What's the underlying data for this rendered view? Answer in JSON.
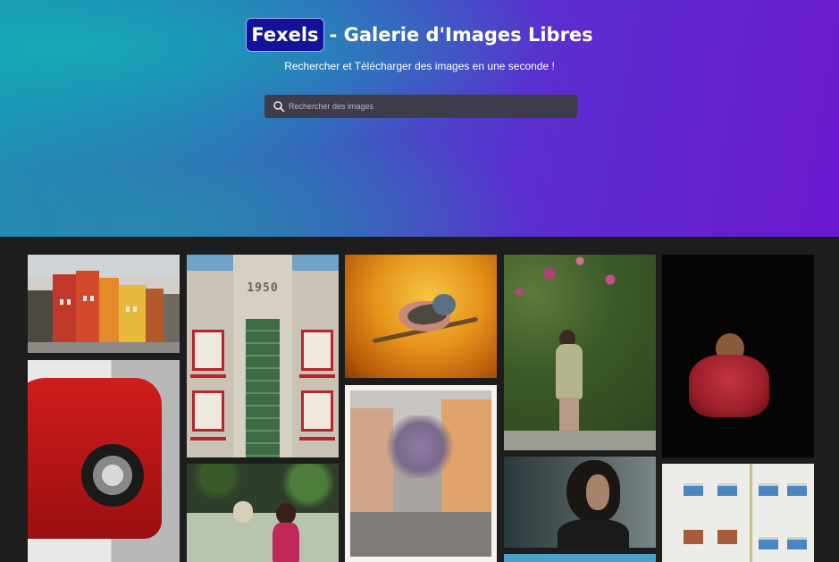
{
  "header": {
    "logo": "Fexels",
    "title_suffix": "- Galerie d'Images Libres",
    "subtitle": "Rechercher et Télécharger des images en une seconde !",
    "search": {
      "placeholder": "Rechercher des images",
      "value": ""
    }
  },
  "colors": {
    "hero_start": "#1e8fb3",
    "hero_end": "#6a18cf",
    "logo_bg": "#14119b",
    "gallery_bg": "#1d1d1d"
  },
  "gallery": {
    "photos": [
      {
        "subject": "colorful buildings",
        "icon": "photo"
      },
      {
        "subject": "1950 building facade",
        "year_text": "1950"
      },
      {
        "subject": "bird on branch"
      },
      {
        "subject": "man among plants"
      },
      {
        "subject": "person in red jacket"
      },
      {
        "subject": "red car"
      },
      {
        "subject": "street with trees"
      },
      {
        "subject": "woman with flowers"
      },
      {
        "subject": "woman portrait"
      },
      {
        "subject": "white building windows"
      },
      {
        "subject": "sky"
      }
    ]
  }
}
